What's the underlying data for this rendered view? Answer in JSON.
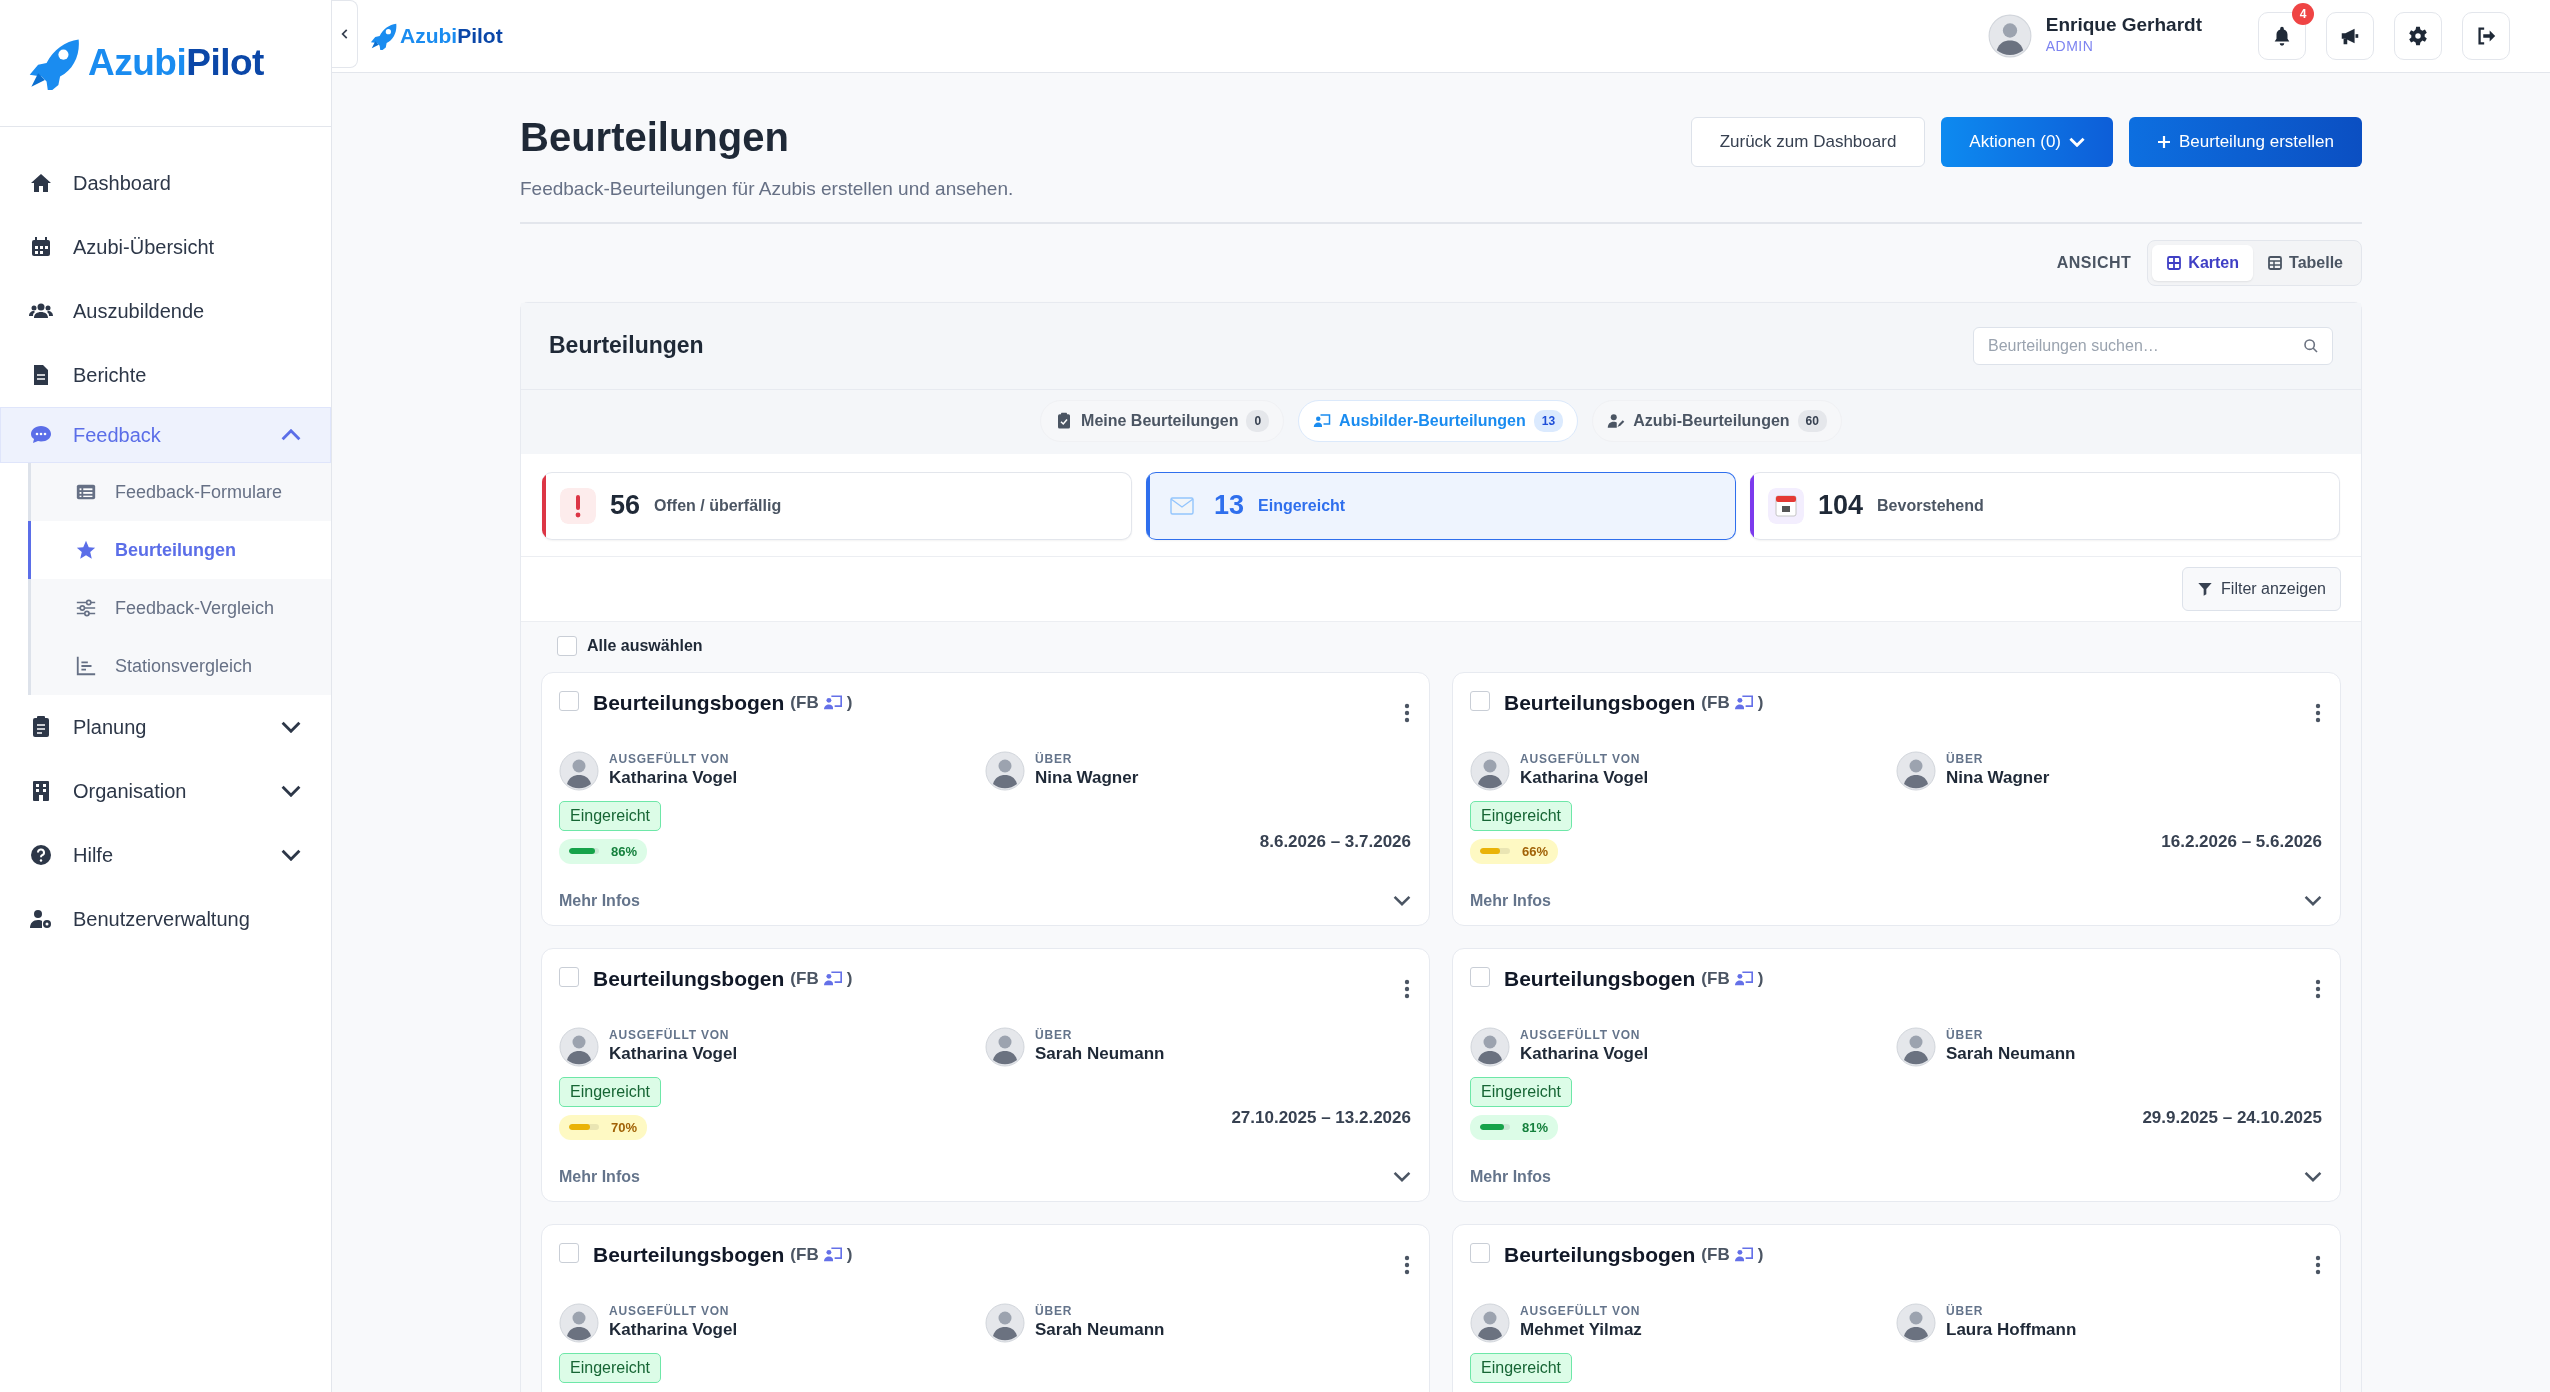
{
  "sidebar": {
    "logo": [
      "Azubi",
      "Pilot"
    ],
    "items": [
      {
        "label": "Dashboard",
        "selected": false
      },
      {
        "label": "Azubi-Übersicht",
        "selected": false
      },
      {
        "label": "Auszubildende",
        "selected": false
      },
      {
        "label": "Berichte",
        "selected": false
      },
      {
        "label": "Feedback",
        "selected": true,
        "expanded": true,
        "children": [
          {
            "label": "Feedback-Formulare",
            "selected": false
          },
          {
            "label": "Beurteilungen",
            "selected": true
          },
          {
            "label": "Feedback-Vergleich",
            "selected": false
          },
          {
            "label": "Stationsvergleich",
            "selected": false
          }
        ]
      },
      {
        "label": "Planung",
        "selected": false,
        "expanded": false
      },
      {
        "label": "Organisation",
        "selected": false,
        "expanded": false
      },
      {
        "label": "Hilfe",
        "selected": false,
        "expanded": false
      },
      {
        "label": "Benutzerverwaltung",
        "selected": false
      }
    ]
  },
  "topbar": {
    "logo": [
      "Azubi",
      "Pilot"
    ],
    "user": {
      "name": "Enrique Gerhardt",
      "role": "ADMIN"
    },
    "notification_count": "4"
  },
  "page": {
    "title": "Beurteilungen",
    "subtitle": "Feedback-Beurteilungen für Azubis erstellen und ansehen.",
    "buttons": [
      {
        "label": "Zurück zum Dashboard",
        "kind": "outline"
      },
      {
        "label": "Aktionen (0)",
        "kind": "dropdown"
      },
      {
        "label": "Beurteilung erstellen",
        "kind": "create"
      }
    ]
  },
  "view_toggle": {
    "label": "ANSICHT",
    "options": [
      {
        "label": "Karten",
        "selected": true
      },
      {
        "label": "Tabelle",
        "selected": false
      }
    ]
  },
  "panel": {
    "title": "Beurteilungen",
    "search": {
      "placeholder": "Beurteilungen suchen…"
    },
    "tabs": [
      {
        "label": "Meine Beurteilungen",
        "count": "0",
        "selected": false
      },
      {
        "label": "Ausbilder-Beurteilungen",
        "count": "13",
        "selected": true
      },
      {
        "label": "Azubi-Beurteilungen",
        "count": "60",
        "selected": false
      }
    ],
    "stats": [
      {
        "value": "56",
        "label": "Offen / überfällig",
        "color": "#dc3545",
        "selected": false
      },
      {
        "value": "13",
        "label": "Eingereicht",
        "color": "#2f6fed",
        "selected": true
      },
      {
        "value": "104",
        "label": "Bevorstehend",
        "color": "#7c3aed",
        "selected": false
      }
    ],
    "filter_button": "Filter anzeigen",
    "select_all": {
      "label": "Alle auswählen",
      "checked": false
    },
    "cards": [
      {
        "title": "Beurteilungsbogen",
        "tag_open": "(FB",
        "tag_close": ")",
        "checked": false,
        "filled_by_label": "AUSGEFÜLLT VON",
        "filled_by": "Katharina Vogel",
        "about_label": "ÜBER",
        "about": "Nina Wagner",
        "status": "Eingereicht",
        "level": 0.86,
        "percent": "86%",
        "dates": "8.6.2026 – 3.7.2026",
        "more": "Mehr Infos"
      },
      {
        "title": "Beurteilungsbogen",
        "tag_open": "(FB",
        "tag_close": ")",
        "checked": false,
        "filled_by_label": "AUSGEFÜLLT VON",
        "filled_by": "Katharina Vogel",
        "about_label": "ÜBER",
        "about": "Nina Wagner",
        "status": "Eingereicht",
        "level": 0.66,
        "percent": "66%",
        "dates": "16.2.2026 – 5.6.2026",
        "more": "Mehr Infos"
      },
      {
        "title": "Beurteilungsbogen",
        "tag_open": "(FB",
        "tag_close": ")",
        "checked": false,
        "filled_by_label": "AUSGEFÜLLT VON",
        "filled_by": "Katharina Vogel",
        "about_label": "ÜBER",
        "about": "Sarah Neumann",
        "status": "Eingereicht",
        "level": 0.7,
        "percent": "70%",
        "dates": "27.10.2025 – 13.2.2026",
        "more": "Mehr Infos"
      },
      {
        "title": "Beurteilungsbogen",
        "tag_open": "(FB",
        "tag_close": ")",
        "checked": false,
        "filled_by_label": "AUSGEFÜLLT VON",
        "filled_by": "Katharina Vogel",
        "about_label": "ÜBER",
        "about": "Sarah Neumann",
        "status": "Eingereicht",
        "level": 0.81,
        "percent": "81%",
        "dates": "29.9.2025 – 24.10.2025",
        "more": "Mehr Infos"
      },
      {
        "title": "Beurteilungsbogen",
        "tag_open": "(FB",
        "tag_close": ")",
        "checked": false,
        "filled_by_label": "AUSGEFÜLLT VON",
        "filled_by": "Katharina Vogel",
        "about_label": "ÜBER",
        "about": "Sarah Neumann",
        "status": "Eingereicht"
      },
      {
        "title": "Beurteilungsbogen",
        "tag_open": "(FB",
        "tag_close": ")",
        "checked": false,
        "filled_by_label": "AUSGEFÜLLT VON",
        "filled_by": "Mehmet Yilmaz",
        "about_label": "ÜBER",
        "about": "Laura Hoffmann",
        "status": "Eingereicht"
      }
    ]
  }
}
